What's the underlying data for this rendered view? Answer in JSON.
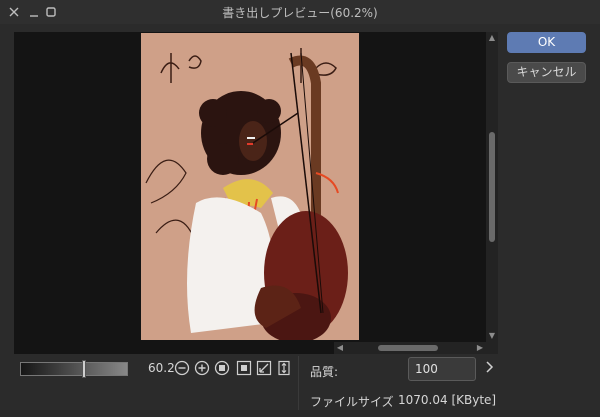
{
  "window": {
    "title": "書き出しプレビュー(60.2%)"
  },
  "buttons": {
    "ok": "OK",
    "cancel": "キャンセル"
  },
  "zoom": {
    "value": "60.2",
    "slider_level": 0.6
  },
  "quality": {
    "label": "品質:",
    "value": "100"
  },
  "file_size": {
    "label": "ファイルサイズ",
    "value": "1070.04 [KByte]"
  },
  "icons": {
    "close": "close-icon",
    "minimize": "minimize-icon",
    "maximize": "maximize-icon",
    "zoom_out": "zoom-out-icon",
    "zoom_in": "zoom-in-icon",
    "actual_size": "actual-size-icon",
    "fit_window": "fit-window-icon",
    "fit_width": "fit-width-icon",
    "fit_height": "fit-height-icon",
    "quality_next": "chevron-right-icon"
  },
  "colors": {
    "accent": "#5e7bb3",
    "artwork_background": "#cfa088"
  }
}
